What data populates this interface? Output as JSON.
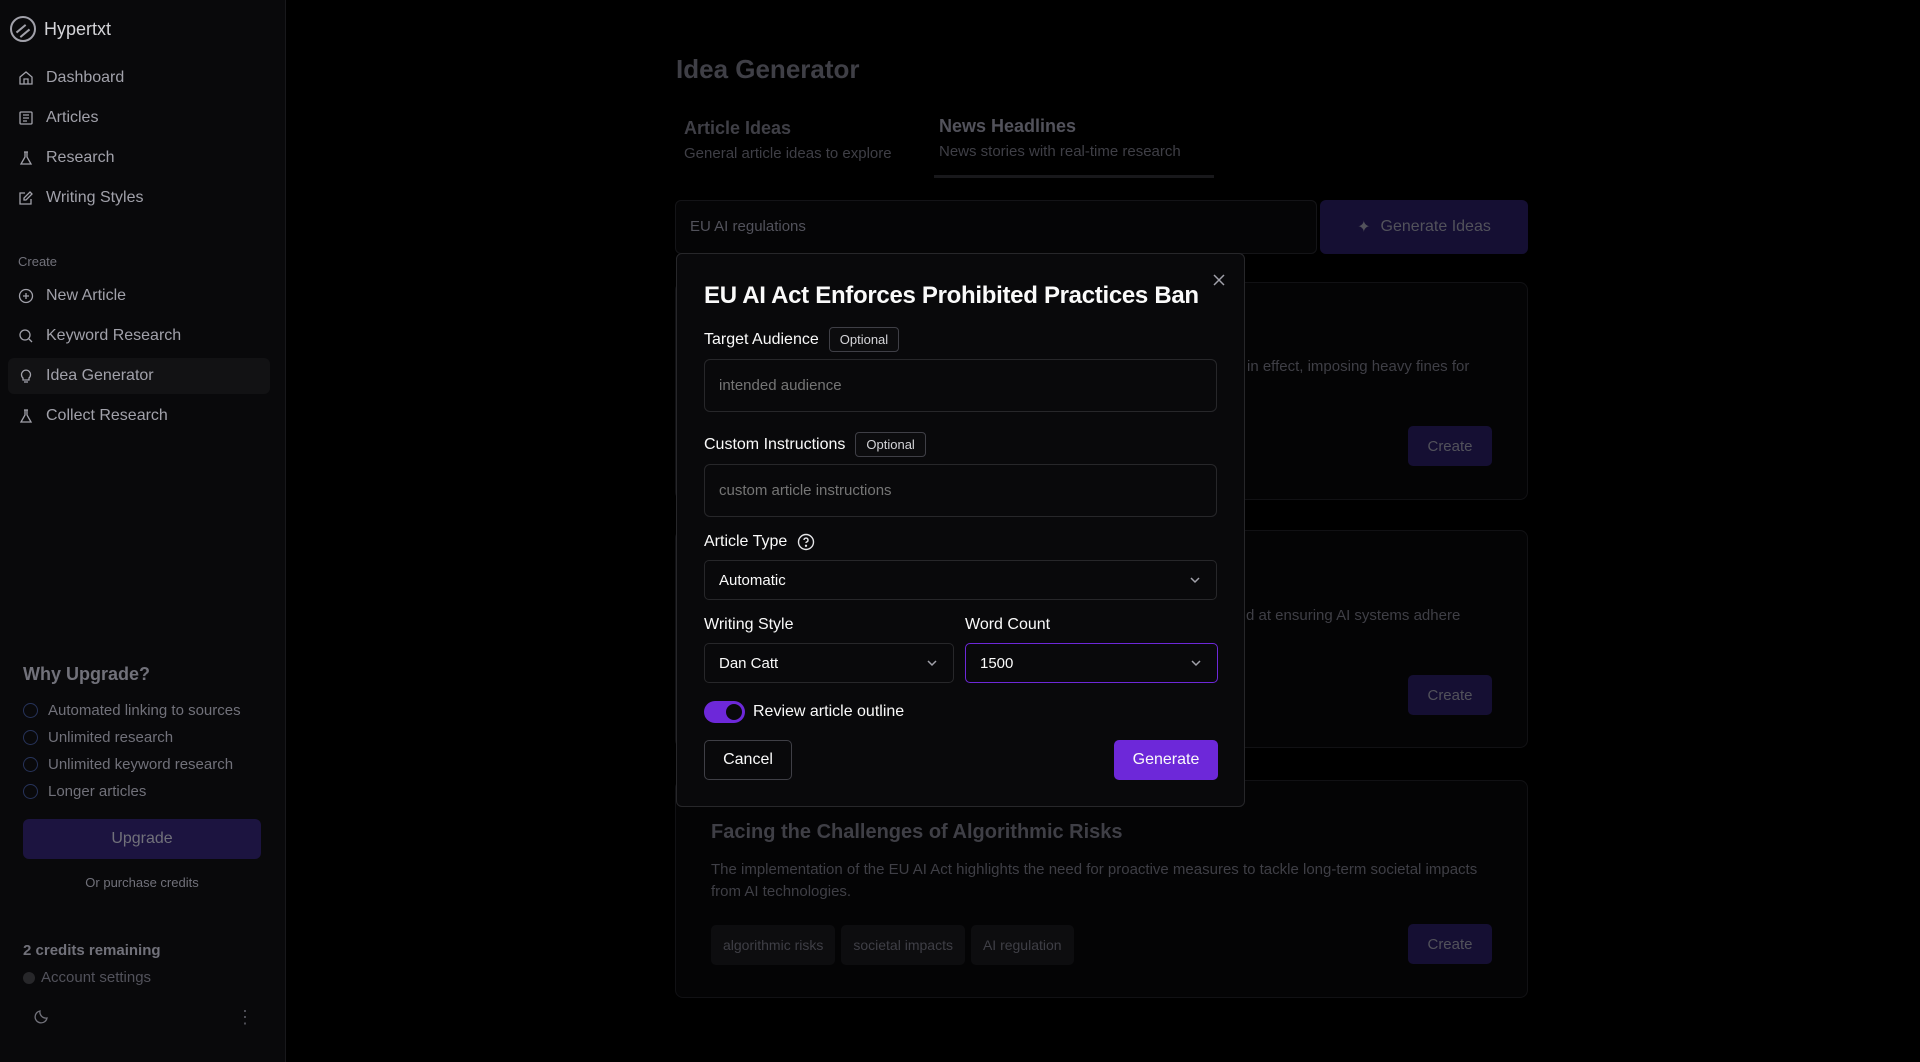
{
  "app": {
    "name": "Hypertxt",
    "logo_icon": "hypertxt-logo-icon"
  },
  "sidebar": {
    "main_nav": [
      {
        "label": "Dashboard",
        "icon": "home-icon"
      },
      {
        "label": "Articles",
        "icon": "document-list-icon"
      },
      {
        "label": "Research",
        "icon": "flask-icon"
      },
      {
        "label": "Writing Styles",
        "icon": "pencil-square-icon"
      }
    ],
    "create_section_label": "Create",
    "create_nav": [
      {
        "label": "New Article",
        "icon": "plus-circle-icon"
      },
      {
        "label": "Keyword Research",
        "icon": "search-icon"
      },
      {
        "label": "Idea Generator",
        "icon": "lightbulb-icon",
        "active": true
      },
      {
        "label": "Collect Research",
        "icon": "flask-icon"
      }
    ],
    "upgrade": {
      "title": "Why Upgrade?",
      "perks": [
        "Automated linking to sources",
        "Unlimited research",
        "Unlimited keyword research",
        "Longer articles"
      ],
      "button_label": "Upgrade",
      "purchase_label": "Or purchase credits"
    },
    "credits": "2 credits remaining",
    "account_settings": "Account settings",
    "theme_icon": "moon-icon",
    "more_icon": "more-vertical-icon"
  },
  "main": {
    "title": "Idea Generator",
    "tabs": [
      {
        "title": "Article Ideas",
        "desc": "General article ideas to explore"
      },
      {
        "title": "News Headlines",
        "desc": "News stories with real-time research",
        "active": true
      }
    ],
    "search_value": "EU AI regulations",
    "generate_ideas_label": "Generate Ideas",
    "cards": [
      {
        "visible_desc_fragment": "in effect, imposing heavy fines for",
        "create_label": "Create"
      },
      {
        "visible_desc_fragment": "d at ensuring AI systems adhere",
        "create_label": "Create"
      },
      {
        "title": "Facing the Challenges of Algorithmic Risks",
        "desc": "The implementation of the EU AI Act highlights the need for proactive measures to tackle long-term societal impacts from AI technologies.",
        "tags": [
          "algorithmic risks",
          "societal impacts",
          "AI regulation"
        ],
        "create_label": "Create"
      }
    ]
  },
  "modal": {
    "title": "EU AI Act Enforces Prohibited Practices Ban",
    "target_audience": {
      "label": "Target Audience",
      "badge": "Optional",
      "placeholder": "intended audience"
    },
    "custom_instructions": {
      "label": "Custom Instructions",
      "badge": "Optional",
      "placeholder": "custom article instructions"
    },
    "article_type": {
      "label": "Article Type",
      "value": "Automatic",
      "help_icon": "help-circle-icon"
    },
    "writing_style": {
      "label": "Writing Style",
      "value": "Dan Catt"
    },
    "word_count": {
      "label": "Word Count",
      "value": "1500"
    },
    "review_outline": {
      "label": "Review article outline",
      "enabled": true
    },
    "cancel_label": "Cancel",
    "generate_label": "Generate"
  },
  "colors": {
    "accent": "#6d28d9",
    "background": "#000000",
    "panel": "#09090b"
  }
}
